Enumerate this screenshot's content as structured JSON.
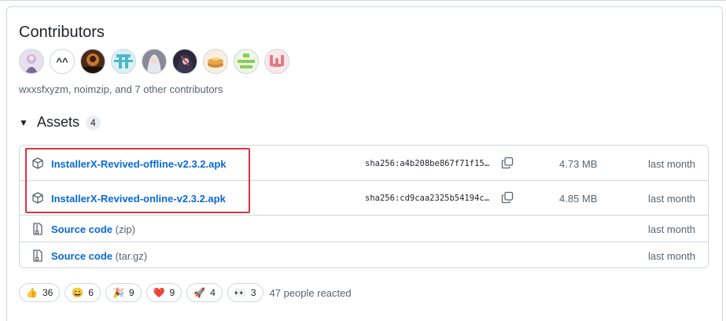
{
  "contributors": {
    "title": "Contributors",
    "summary": "wxxsfxyzm, noimzip, and 7 other contributors",
    "avatars": [
      {
        "name": "avatar-anime-girl",
        "bg": "#e8e0ee"
      },
      {
        "name": "avatar-caret-face",
        "bg": "#ffffff",
        "text": "^^"
      },
      {
        "name": "avatar-dark-portrait",
        "bg": "#4a2a1a"
      },
      {
        "name": "avatar-teal-identicon",
        "bg": "#d9f1f4"
      },
      {
        "name": "avatar-white-hair",
        "bg": "#8a8a96"
      },
      {
        "name": "avatar-dark-anime",
        "bg": "#2a2838"
      },
      {
        "name": "avatar-pancake",
        "bg": "#f7f0e2"
      },
      {
        "name": "avatar-green-identicon",
        "bg": "#eef7e6"
      },
      {
        "name": "avatar-pink-identicon",
        "bg": "#fbe8ea"
      }
    ]
  },
  "assets": {
    "title": "Assets",
    "count": "4",
    "rows": [
      {
        "name": "InstallerX-Revived-offline-v2.3.2.apk",
        "sha": "sha256:a4b208be867f71f15…",
        "size": "4.73 MB",
        "date": "last month"
      },
      {
        "name": "InstallerX-Revived-online-v2.3.2.apk",
        "sha": "sha256:cd9caa2325b54194c…",
        "size": "4.85 MB",
        "date": "last month"
      },
      {
        "name": "Source code",
        "paren": "(zip)",
        "date": "last month"
      },
      {
        "name": "Source code",
        "paren": "(tar.gz)",
        "date": "last month"
      }
    ]
  },
  "reactions": {
    "items": [
      {
        "emoji": "👍",
        "count": "36"
      },
      {
        "emoji": "😄",
        "count": "6"
      },
      {
        "emoji": "🎉",
        "count": "9"
      },
      {
        "emoji": "❤️",
        "count": "9"
      },
      {
        "emoji": "🚀",
        "count": "4"
      },
      {
        "emoji": "👀",
        "count": "3"
      }
    ],
    "summary": "47 people reacted"
  },
  "colors": {
    "link": "#0969da",
    "highlight": "#e0343f",
    "border": "#d0d7de"
  }
}
